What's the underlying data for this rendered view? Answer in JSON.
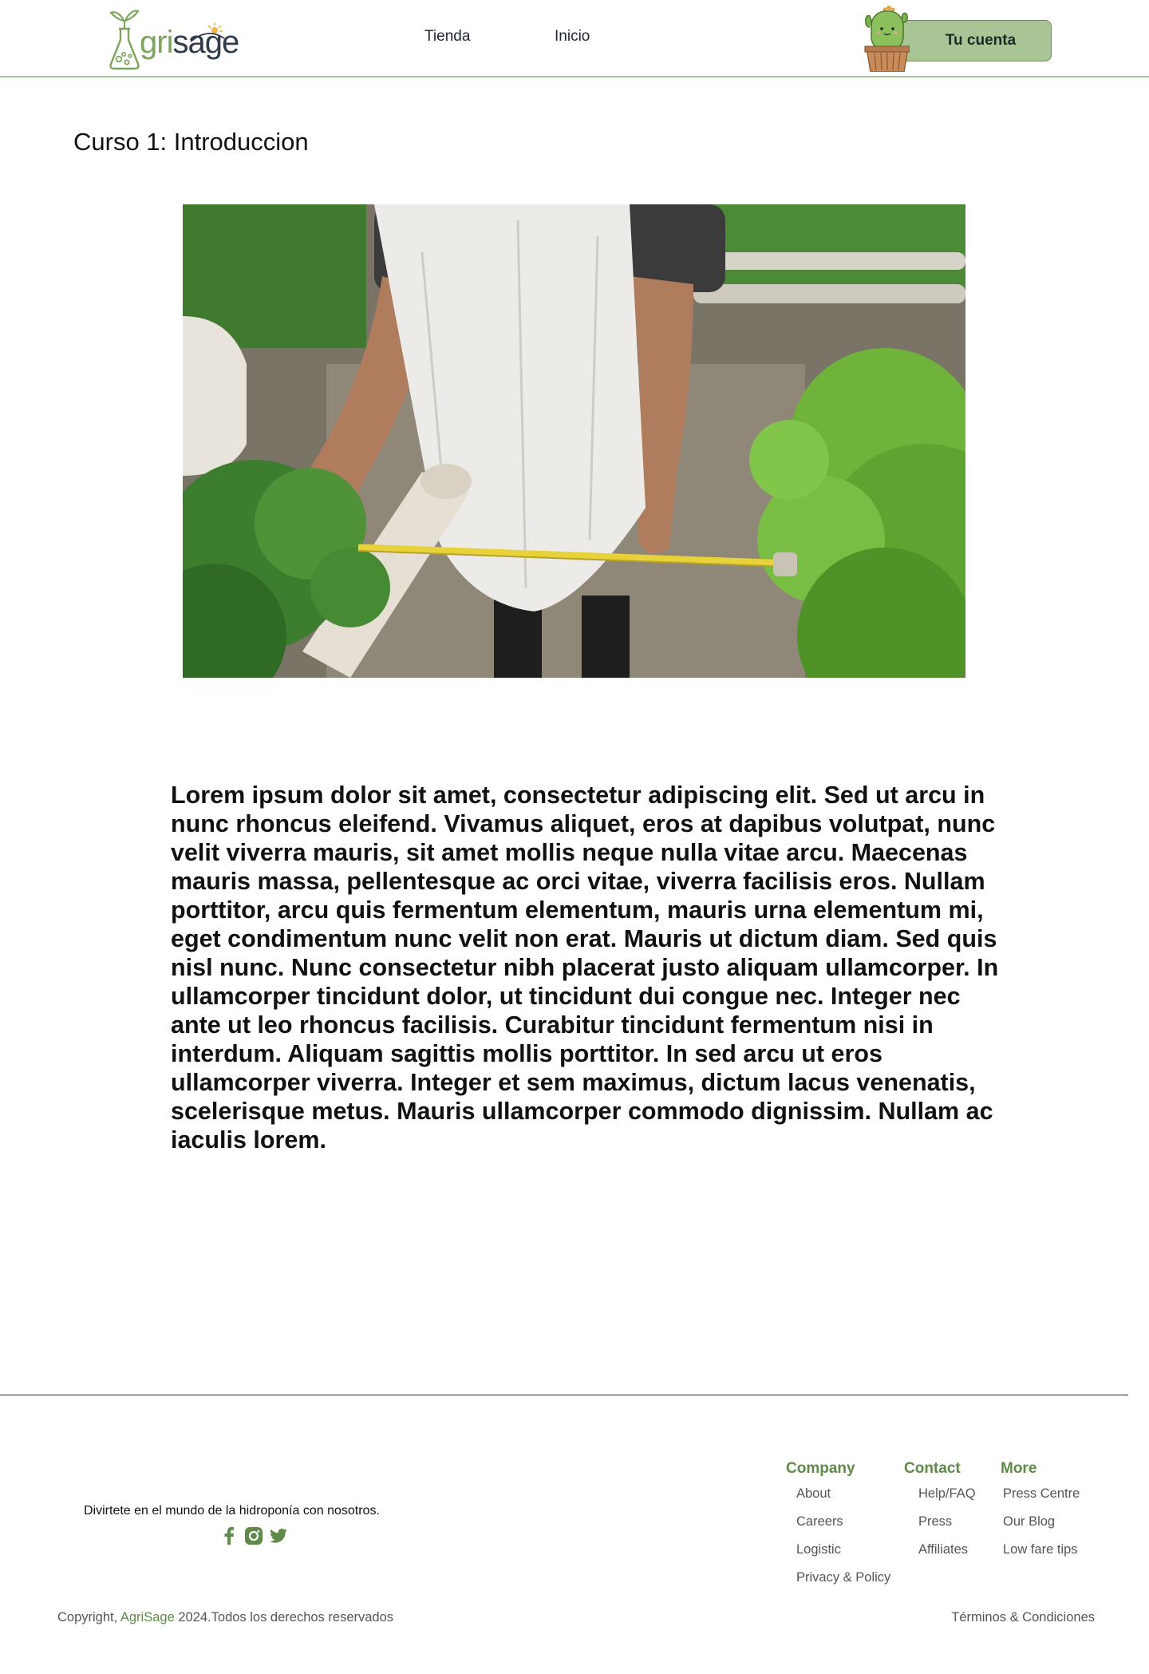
{
  "header": {
    "logo_text_prefix": "A",
    "logo_text_green": "gri",
    "logo_text_dark": "sage",
    "nav": [
      {
        "label": "Tienda"
      },
      {
        "label": "Inicio"
      }
    ],
    "account_button_label": "Tu cuenta"
  },
  "main": {
    "course_title": "Curso 1: Introduccion",
    "body_text": "Lorem ipsum dolor sit amet, consectetur adipiscing elit. Sed ut arcu in nunc rhoncus eleifend. Vivamus aliquet, eros at dapibus volutpat, nunc velit viverra mauris, sit amet mollis neque nulla vitae arcu. Maecenas mauris massa, pellentesque ac orci vitae, viverra facilisis eros. Nullam porttitor, arcu quis fermentum elementum, mauris urna elementum mi, eget condimentum nunc velit non erat. Mauris ut dictum diam. Sed quis nisl nunc. Nunc consectetur nibh placerat justo aliquam ullamcorper. In ullamcorper tincidunt dolor, ut tincidunt dui congue nec. Integer nec ante ut leo rhoncus facilisis. Curabitur tincidunt fermentum nisi in interdum. Aliquam sagittis mollis porttitor. In sed arcu ut eros ullamcorper viverra. Integer et sem maximus, dictum lacus venenatis, scelerisque metus. Mauris ullamcorper commodo dignissim. Nullam ac iaculis lorem."
  },
  "footer": {
    "tagline": "Divirtete en el mundo de la hidroponía con nosotros.",
    "social_icons": [
      "facebook-icon",
      "instagram-icon",
      "twitter-icon"
    ],
    "columns": [
      {
        "heading": "Company",
        "links": [
          "About",
          "Careers",
          "Logistic",
          "Privacy & Policy"
        ]
      },
      {
        "heading": "Contact",
        "links": [
          "Help/FAQ",
          "Press",
          "Affiliates"
        ]
      },
      {
        "heading": "More",
        "links": [
          "Press Centre",
          "Our Blog",
          "Low fare tips"
        ]
      }
    ],
    "copyright_prefix": "Copyright, ",
    "copyright_brand": "AgriSage",
    "copyright_suffix": " 2024.Todos los derechos reservados",
    "terms": "Términos & Condiciones"
  },
  "colors": {
    "accent_green": "#a9c596",
    "brand_green": "#5f8a47",
    "text_dark": "#111111"
  }
}
